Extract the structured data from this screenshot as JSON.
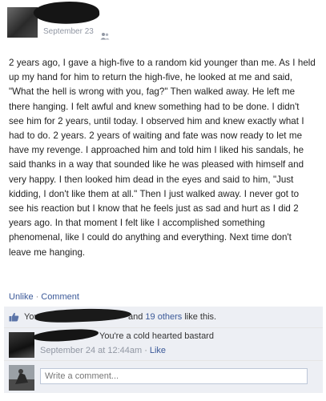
{
  "post": {
    "date": "September 23",
    "audience_icon": "friends-icon",
    "body": "2 years ago, I gave a high-five to a random kid younger than me. As I held up my hand for him to return the high-five, he looked at me and said, \"What the hell is wrong with you, fag?\" Then walked away. He left me there hanging. I felt awful and knew something had to be done. I didn't see him for 2 years, until today. I observed him and knew exactly what I had to do. 2 years. 2 years of waiting and fate was now ready to let me have my revenge. I approached him and told him I liked his sandals, he said thanks in a way that sounded like he was pleased with himself and very happy. I then looked him dead in the eyes and said to him, \"Just kidding, I don't like them at all.\" Then I just walked away. I never got to see his reaction but I know that he feels just as sad and hurt as I did 2 years ago. In that moment I felt like I accomplished something phenomenal, like I could do anything and everything. Next time don't leave me hanging."
  },
  "actions": {
    "unlike": "Unlike",
    "separator": "·",
    "comment": "Comment"
  },
  "likes": {
    "icon": "thumbs-up-icon",
    "you": "You",
    "and": "and",
    "others": "19 others",
    "suffix": "like this."
  },
  "comment": {
    "text": "You're a cold hearted bastard",
    "time": "September 24 at 12:44am",
    "separator": "·",
    "like": "Like"
  },
  "compose": {
    "placeholder": "Write a comment..."
  },
  "colors": {
    "link": "#3b5998",
    "meta": "#9197a3",
    "feedback_bg": "#edeff4"
  }
}
